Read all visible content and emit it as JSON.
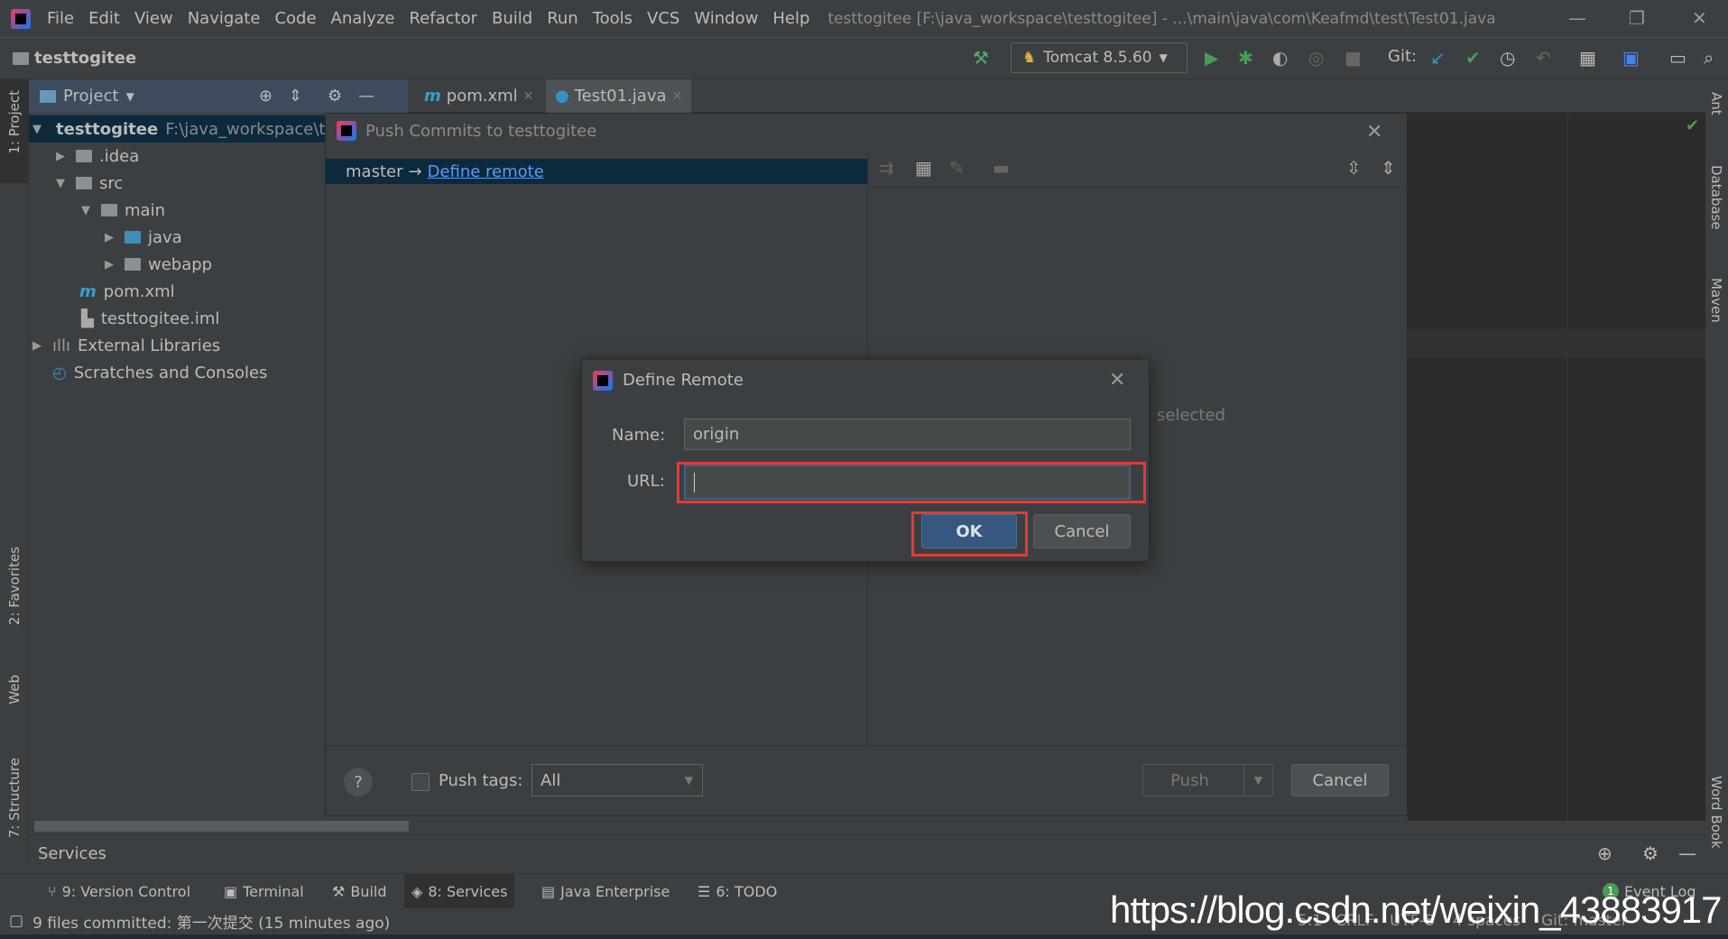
{
  "menubar": {
    "items": [
      "File",
      "Edit",
      "View",
      "Navigate",
      "Code",
      "Analyze",
      "Refactor",
      "Build",
      "Run",
      "Tools",
      "VCS",
      "Window",
      "Help"
    ],
    "window_title": "testtogitee [F:\\java_workspace\\testtogitee] - ...\\main\\java\\com\\Keafmd\\test\\Test01.java"
  },
  "navbar": {
    "project": "testtogitee",
    "run_config": "Tomcat 8.5.60",
    "git_label": "Git:"
  },
  "tabs": {
    "project_panel": "Project",
    "files": [
      {
        "label": "pom.xml",
        "active": false
      },
      {
        "label": "Test01.java",
        "active": true
      }
    ]
  },
  "left_strip": {
    "project": "1: Project",
    "favorites": "2: Favorites",
    "web": "Web",
    "structure": "7: Structure"
  },
  "right_strip": {
    "ant": "Ant",
    "database": "Database",
    "maven": "Maven",
    "wordbook": "Word Book"
  },
  "tree": [
    {
      "label": "testtogitee",
      "path": "F:\\java_workspace\\t",
      "expanded": true
    },
    {
      "label": ".idea"
    },
    {
      "label": "src"
    },
    {
      "label": "main"
    },
    {
      "label": "java"
    },
    {
      "label": "webapp"
    },
    {
      "label": "pom.xml"
    },
    {
      "label": "testtogitee.iml"
    },
    {
      "label": "External Libraries"
    },
    {
      "label": "Scratches and Consoles"
    }
  ],
  "push_dialog": {
    "title": "Push Commits to testtogitee",
    "branch": "master",
    "arrow": "→",
    "define_remote": "Define remote",
    "no_selection_text": "selected",
    "push_tags_label": "Push tags:",
    "tags_value": "All",
    "push_label": "Push",
    "cancel_label": "Cancel",
    "help": "?"
  },
  "define_remote": {
    "title": "Define Remote",
    "name_label": "Name:",
    "name_value": "origin",
    "url_label": "URL:",
    "url_value": "",
    "ok_label": "OK",
    "cancel_label": "Cancel"
  },
  "services": {
    "title": "Services"
  },
  "tool_tabs": [
    "9: Version Control",
    "Terminal",
    "Build",
    "8: Services",
    "Java Enterprise",
    "6: TODO"
  ],
  "event_log": {
    "label": "Event Log",
    "count": "1"
  },
  "status": {
    "message": "9 files committed: 第一次提交 (15 minutes ago)",
    "position": "5:1",
    "line_sep": "CRLF",
    "encoding": "UTF-8",
    "indent": "4 spaces",
    "git": "Git: master"
  },
  "watermark": "https://blog.csdn.net/weixin_43883917",
  "colors": {
    "highlight": "#e53935",
    "accent": "#365880",
    "link": "#589df6"
  }
}
